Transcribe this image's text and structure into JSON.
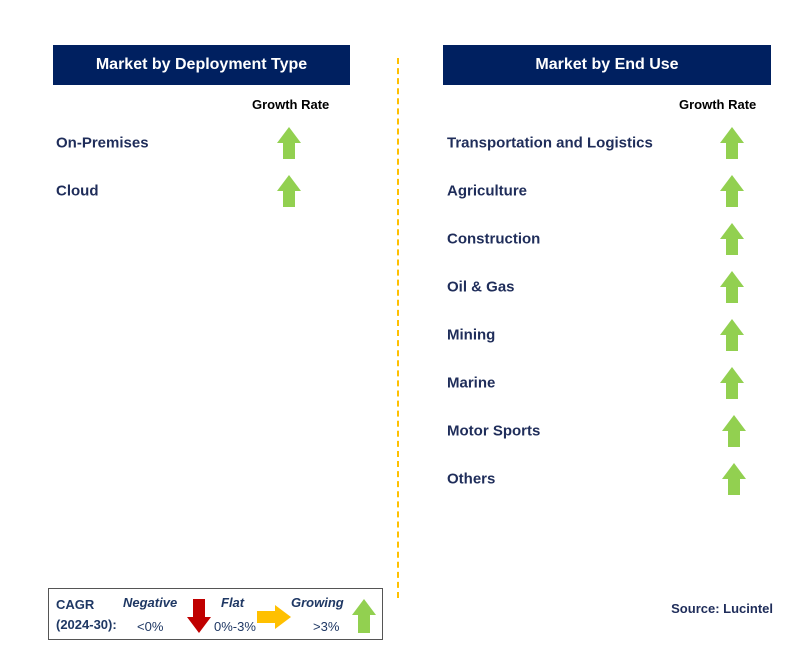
{
  "left_panel": {
    "title": "Market by Deployment Type",
    "growth_rate_label": "Growth Rate",
    "items": [
      {
        "label": "On-Premises",
        "trend": "growing"
      },
      {
        "label": "Cloud",
        "trend": "growing"
      }
    ]
  },
  "right_panel": {
    "title": "Market by End Use",
    "growth_rate_label": "Growth Rate",
    "items": [
      {
        "label": "Transportation and Logistics",
        "trend": "growing"
      },
      {
        "label": "Agriculture",
        "trend": "growing"
      },
      {
        "label": "Construction",
        "trend": "growing"
      },
      {
        "label": "Oil & Gas",
        "trend": "growing"
      },
      {
        "label": "Mining",
        "trend": "growing"
      },
      {
        "label": "Marine",
        "trend": "growing"
      },
      {
        "label": "Motor Sports",
        "trend": "growing"
      },
      {
        "label": "Others",
        "trend": "growing"
      }
    ]
  },
  "legend": {
    "cagr_label": "CAGR",
    "period": "(2024-30):",
    "negative": "Negative",
    "negative_range": "<0%",
    "flat": "Flat",
    "flat_range": "0%-3%",
    "growing": "Growing",
    "growing_range": ">3%"
  },
  "source": "Source: Lucintel",
  "colors": {
    "header": "#002060",
    "growing": "#92d050",
    "negative": "#c00000",
    "flat": "#ffc000",
    "divider": "#ffc000"
  },
  "icons": {
    "growing": "arrow-up-icon",
    "negative": "arrow-down-icon",
    "flat": "arrow-right-icon"
  }
}
